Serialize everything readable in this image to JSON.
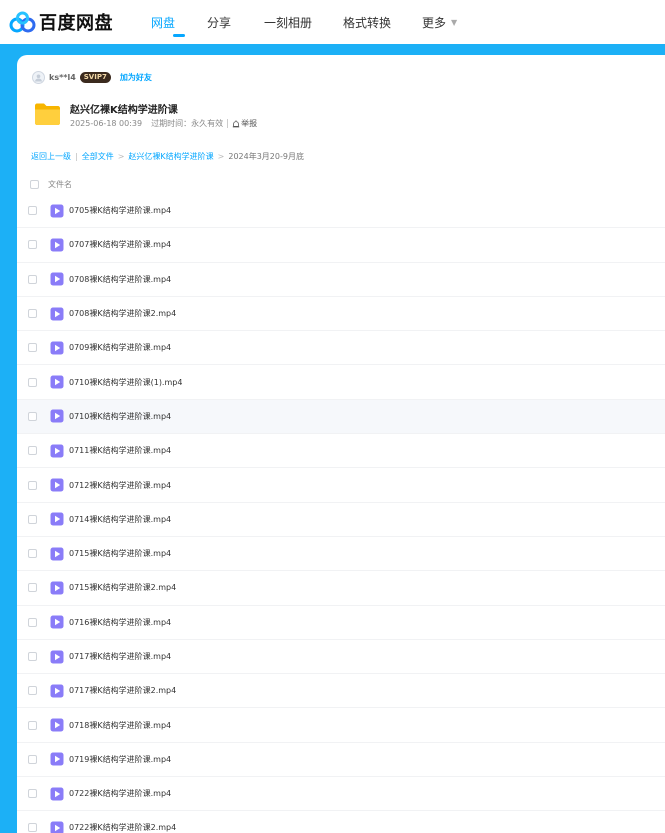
{
  "app": {
    "logo_text": "百度网盘",
    "brand_color": "#06a7ff"
  },
  "nav": {
    "items": [
      "网盘",
      "分享",
      "一刻相册",
      "格式转换",
      "更多"
    ],
    "active": "网盘"
  },
  "share": {
    "user_name": "ks**l4",
    "vip_badge": "SVIP7",
    "add_friend": "加为好友",
    "folder_title": "赵兴亿裸K结构学进阶课",
    "date": "2025-06-18 00:39",
    "expire_label": "过期时间：永久有效",
    "report_label": "举报"
  },
  "breadcrumb": {
    "back": "返回上一级",
    "root": "全部文件",
    "folder": "赵兴亿裸K结构学进阶课",
    "current": "2024年3月20-9月底"
  },
  "list": {
    "column_title": "文件名",
    "files": [
      "0705裸K结构学进阶课.mp4",
      "0707裸K结构学进阶课.mp4",
      "0708裸K结构学进阶课.mp4",
      "0708裸K结构学进阶课2.mp4",
      "0709裸K结构学进阶课.mp4",
      "0710裸K结构学进阶课(1).mp4",
      "0710裸K结构学进阶课.mp4",
      "0711裸K结构学进阶课.mp4",
      "0712裸K结构学进阶课.mp4",
      "0714裸K结构学进阶课.mp4",
      "0715裸K结构学进阶课.mp4",
      "0715裸K结构学进阶课2.mp4",
      "0716裸K结构学进阶课.mp4",
      "0717裸K结构学进阶课.mp4",
      "0717裸K结构学进阶课2.mp4",
      "0718裸K结构学进阶课.mp4",
      "0719裸K结构学进阶课.mp4",
      "0722裸K结构学进阶课.mp4",
      "0722裸K结构学进阶课2.mp4"
    ],
    "hover_index": 6
  },
  "icons": {
    "logo": "baidu-netdisk-logo-icon",
    "folder": "folder-icon",
    "video": "video-file-icon",
    "report": "report-icon",
    "avatar": "user-avatar-icon"
  }
}
